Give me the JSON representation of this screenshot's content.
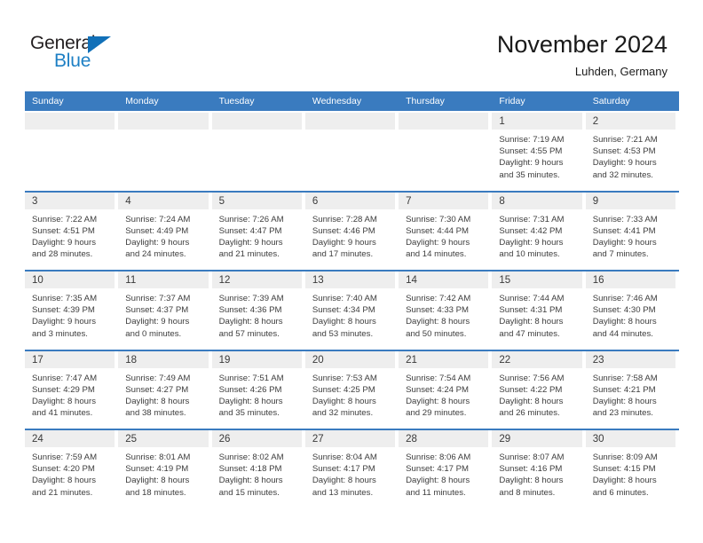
{
  "brand": {
    "name_part1": "General",
    "name_part2": "Blue",
    "triangle_color": "#1170b8",
    "blue_color": "#1d7fc4"
  },
  "header": {
    "title": "November 2024",
    "subtitle": "Luhden, Germany",
    "accent_color": "#3a7bbf",
    "date_band_color": "#eeeeee"
  },
  "weekdays": [
    "Sunday",
    "Monday",
    "Tuesday",
    "Wednesday",
    "Thursday",
    "Friday",
    "Saturday"
  ],
  "weeks": [
    [
      {
        "date": "",
        "empty": true
      },
      {
        "date": "",
        "empty": true
      },
      {
        "date": "",
        "empty": true
      },
      {
        "date": "",
        "empty": true
      },
      {
        "date": "",
        "empty": true
      },
      {
        "date": "1",
        "sunrise": "Sunrise: 7:19 AM",
        "sunset": "Sunset: 4:55 PM",
        "daylight1": "Daylight: 9 hours",
        "daylight2": "and 35 minutes."
      },
      {
        "date": "2",
        "sunrise": "Sunrise: 7:21 AM",
        "sunset": "Sunset: 4:53 PM",
        "daylight1": "Daylight: 9 hours",
        "daylight2": "and 32 minutes."
      }
    ],
    [
      {
        "date": "3",
        "sunrise": "Sunrise: 7:22 AM",
        "sunset": "Sunset: 4:51 PM",
        "daylight1": "Daylight: 9 hours",
        "daylight2": "and 28 minutes."
      },
      {
        "date": "4",
        "sunrise": "Sunrise: 7:24 AM",
        "sunset": "Sunset: 4:49 PM",
        "daylight1": "Daylight: 9 hours",
        "daylight2": "and 24 minutes."
      },
      {
        "date": "5",
        "sunrise": "Sunrise: 7:26 AM",
        "sunset": "Sunset: 4:47 PM",
        "daylight1": "Daylight: 9 hours",
        "daylight2": "and 21 minutes."
      },
      {
        "date": "6",
        "sunrise": "Sunrise: 7:28 AM",
        "sunset": "Sunset: 4:46 PM",
        "daylight1": "Daylight: 9 hours",
        "daylight2": "and 17 minutes."
      },
      {
        "date": "7",
        "sunrise": "Sunrise: 7:30 AM",
        "sunset": "Sunset: 4:44 PM",
        "daylight1": "Daylight: 9 hours",
        "daylight2": "and 14 minutes."
      },
      {
        "date": "8",
        "sunrise": "Sunrise: 7:31 AM",
        "sunset": "Sunset: 4:42 PM",
        "daylight1": "Daylight: 9 hours",
        "daylight2": "and 10 minutes."
      },
      {
        "date": "9",
        "sunrise": "Sunrise: 7:33 AM",
        "sunset": "Sunset: 4:41 PM",
        "daylight1": "Daylight: 9 hours",
        "daylight2": "and 7 minutes."
      }
    ],
    [
      {
        "date": "10",
        "sunrise": "Sunrise: 7:35 AM",
        "sunset": "Sunset: 4:39 PM",
        "daylight1": "Daylight: 9 hours",
        "daylight2": "and 3 minutes."
      },
      {
        "date": "11",
        "sunrise": "Sunrise: 7:37 AM",
        "sunset": "Sunset: 4:37 PM",
        "daylight1": "Daylight: 9 hours",
        "daylight2": "and 0 minutes."
      },
      {
        "date": "12",
        "sunrise": "Sunrise: 7:39 AM",
        "sunset": "Sunset: 4:36 PM",
        "daylight1": "Daylight: 8 hours",
        "daylight2": "and 57 minutes."
      },
      {
        "date": "13",
        "sunrise": "Sunrise: 7:40 AM",
        "sunset": "Sunset: 4:34 PM",
        "daylight1": "Daylight: 8 hours",
        "daylight2": "and 53 minutes."
      },
      {
        "date": "14",
        "sunrise": "Sunrise: 7:42 AM",
        "sunset": "Sunset: 4:33 PM",
        "daylight1": "Daylight: 8 hours",
        "daylight2": "and 50 minutes."
      },
      {
        "date": "15",
        "sunrise": "Sunrise: 7:44 AM",
        "sunset": "Sunset: 4:31 PM",
        "daylight1": "Daylight: 8 hours",
        "daylight2": "and 47 minutes."
      },
      {
        "date": "16",
        "sunrise": "Sunrise: 7:46 AM",
        "sunset": "Sunset: 4:30 PM",
        "daylight1": "Daylight: 8 hours",
        "daylight2": "and 44 minutes."
      }
    ],
    [
      {
        "date": "17",
        "sunrise": "Sunrise: 7:47 AM",
        "sunset": "Sunset: 4:29 PM",
        "daylight1": "Daylight: 8 hours",
        "daylight2": "and 41 minutes."
      },
      {
        "date": "18",
        "sunrise": "Sunrise: 7:49 AM",
        "sunset": "Sunset: 4:27 PM",
        "daylight1": "Daylight: 8 hours",
        "daylight2": "and 38 minutes."
      },
      {
        "date": "19",
        "sunrise": "Sunrise: 7:51 AM",
        "sunset": "Sunset: 4:26 PM",
        "daylight1": "Daylight: 8 hours",
        "daylight2": "and 35 minutes."
      },
      {
        "date": "20",
        "sunrise": "Sunrise: 7:53 AM",
        "sunset": "Sunset: 4:25 PM",
        "daylight1": "Daylight: 8 hours",
        "daylight2": "and 32 minutes."
      },
      {
        "date": "21",
        "sunrise": "Sunrise: 7:54 AM",
        "sunset": "Sunset: 4:24 PM",
        "daylight1": "Daylight: 8 hours",
        "daylight2": "and 29 minutes."
      },
      {
        "date": "22",
        "sunrise": "Sunrise: 7:56 AM",
        "sunset": "Sunset: 4:22 PM",
        "daylight1": "Daylight: 8 hours",
        "daylight2": "and 26 minutes."
      },
      {
        "date": "23",
        "sunrise": "Sunrise: 7:58 AM",
        "sunset": "Sunset: 4:21 PM",
        "daylight1": "Daylight: 8 hours",
        "daylight2": "and 23 minutes."
      }
    ],
    [
      {
        "date": "24",
        "sunrise": "Sunrise: 7:59 AM",
        "sunset": "Sunset: 4:20 PM",
        "daylight1": "Daylight: 8 hours",
        "daylight2": "and 21 minutes."
      },
      {
        "date": "25",
        "sunrise": "Sunrise: 8:01 AM",
        "sunset": "Sunset: 4:19 PM",
        "daylight1": "Daylight: 8 hours",
        "daylight2": "and 18 minutes."
      },
      {
        "date": "26",
        "sunrise": "Sunrise: 8:02 AM",
        "sunset": "Sunset: 4:18 PM",
        "daylight1": "Daylight: 8 hours",
        "daylight2": "and 15 minutes."
      },
      {
        "date": "27",
        "sunrise": "Sunrise: 8:04 AM",
        "sunset": "Sunset: 4:17 PM",
        "daylight1": "Daylight: 8 hours",
        "daylight2": "and 13 minutes."
      },
      {
        "date": "28",
        "sunrise": "Sunrise: 8:06 AM",
        "sunset": "Sunset: 4:17 PM",
        "daylight1": "Daylight: 8 hours",
        "daylight2": "and 11 minutes."
      },
      {
        "date": "29",
        "sunrise": "Sunrise: 8:07 AM",
        "sunset": "Sunset: 4:16 PM",
        "daylight1": "Daylight: 8 hours",
        "daylight2": "and 8 minutes."
      },
      {
        "date": "30",
        "sunrise": "Sunrise: 8:09 AM",
        "sunset": "Sunset: 4:15 PM",
        "daylight1": "Daylight: 8 hours",
        "daylight2": "and 6 minutes."
      }
    ]
  ]
}
